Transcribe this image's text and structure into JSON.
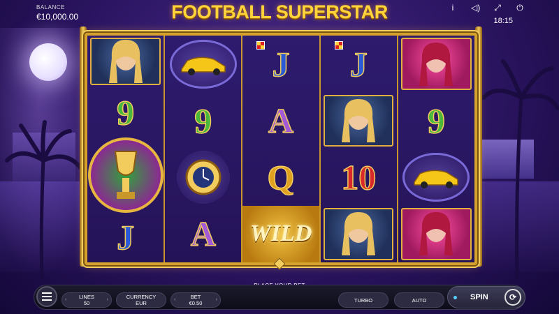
{
  "game": {
    "title": "FOOTBALL SUPERSTAR",
    "clock": "18:15",
    "accent_color": "#ffd43a"
  },
  "balance": {
    "label": "BALANCE",
    "value": "€10,000.00"
  },
  "top_icons": [
    "info-icon",
    "sound-icon",
    "fullscreen-icon",
    "power-icon"
  ],
  "reels": [
    [
      {
        "symbol": "blonde-woman",
        "text": ""
      },
      {
        "symbol": "nine",
        "text": "9"
      },
      {
        "symbol": "trophy",
        "text": ""
      },
      {
        "symbol": "J",
        "text": "J"
      }
    ],
    [
      {
        "symbol": "sports-car",
        "text": ""
      },
      {
        "symbol": "nine",
        "text": "9"
      },
      {
        "symbol": "gold-watch",
        "text": ""
      },
      {
        "symbol": "A",
        "text": "A"
      }
    ],
    [
      {
        "symbol": "J",
        "text": "J"
      },
      {
        "symbol": "A",
        "text": "A"
      },
      {
        "symbol": "Q",
        "text": "Q"
      },
      {
        "symbol": "wild",
        "text": "WILD"
      }
    ],
    [
      {
        "symbol": "J",
        "text": "J"
      },
      {
        "symbol": "blonde-woman",
        "text": ""
      },
      {
        "symbol": "ten",
        "text": "10"
      },
      {
        "symbol": "blonde-woman",
        "text": ""
      }
    ],
    [
      {
        "symbol": "red-hair-woman",
        "text": ""
      },
      {
        "symbol": "nine",
        "text": "9"
      },
      {
        "symbol": "sports-car",
        "text": ""
      },
      {
        "symbol": "red-hair-woman",
        "text": ""
      }
    ]
  ],
  "controls": {
    "place_bet_text": "PLACE YOUR BET",
    "lines": {
      "label": "LINES",
      "value": "50"
    },
    "currency": {
      "label": "CURRENCY",
      "value": "EUR"
    },
    "bet": {
      "label": "BET",
      "value": "€0.50"
    },
    "turbo_label": "TURBO",
    "auto_label": "AUTO",
    "spin_label": "SPIN"
  }
}
